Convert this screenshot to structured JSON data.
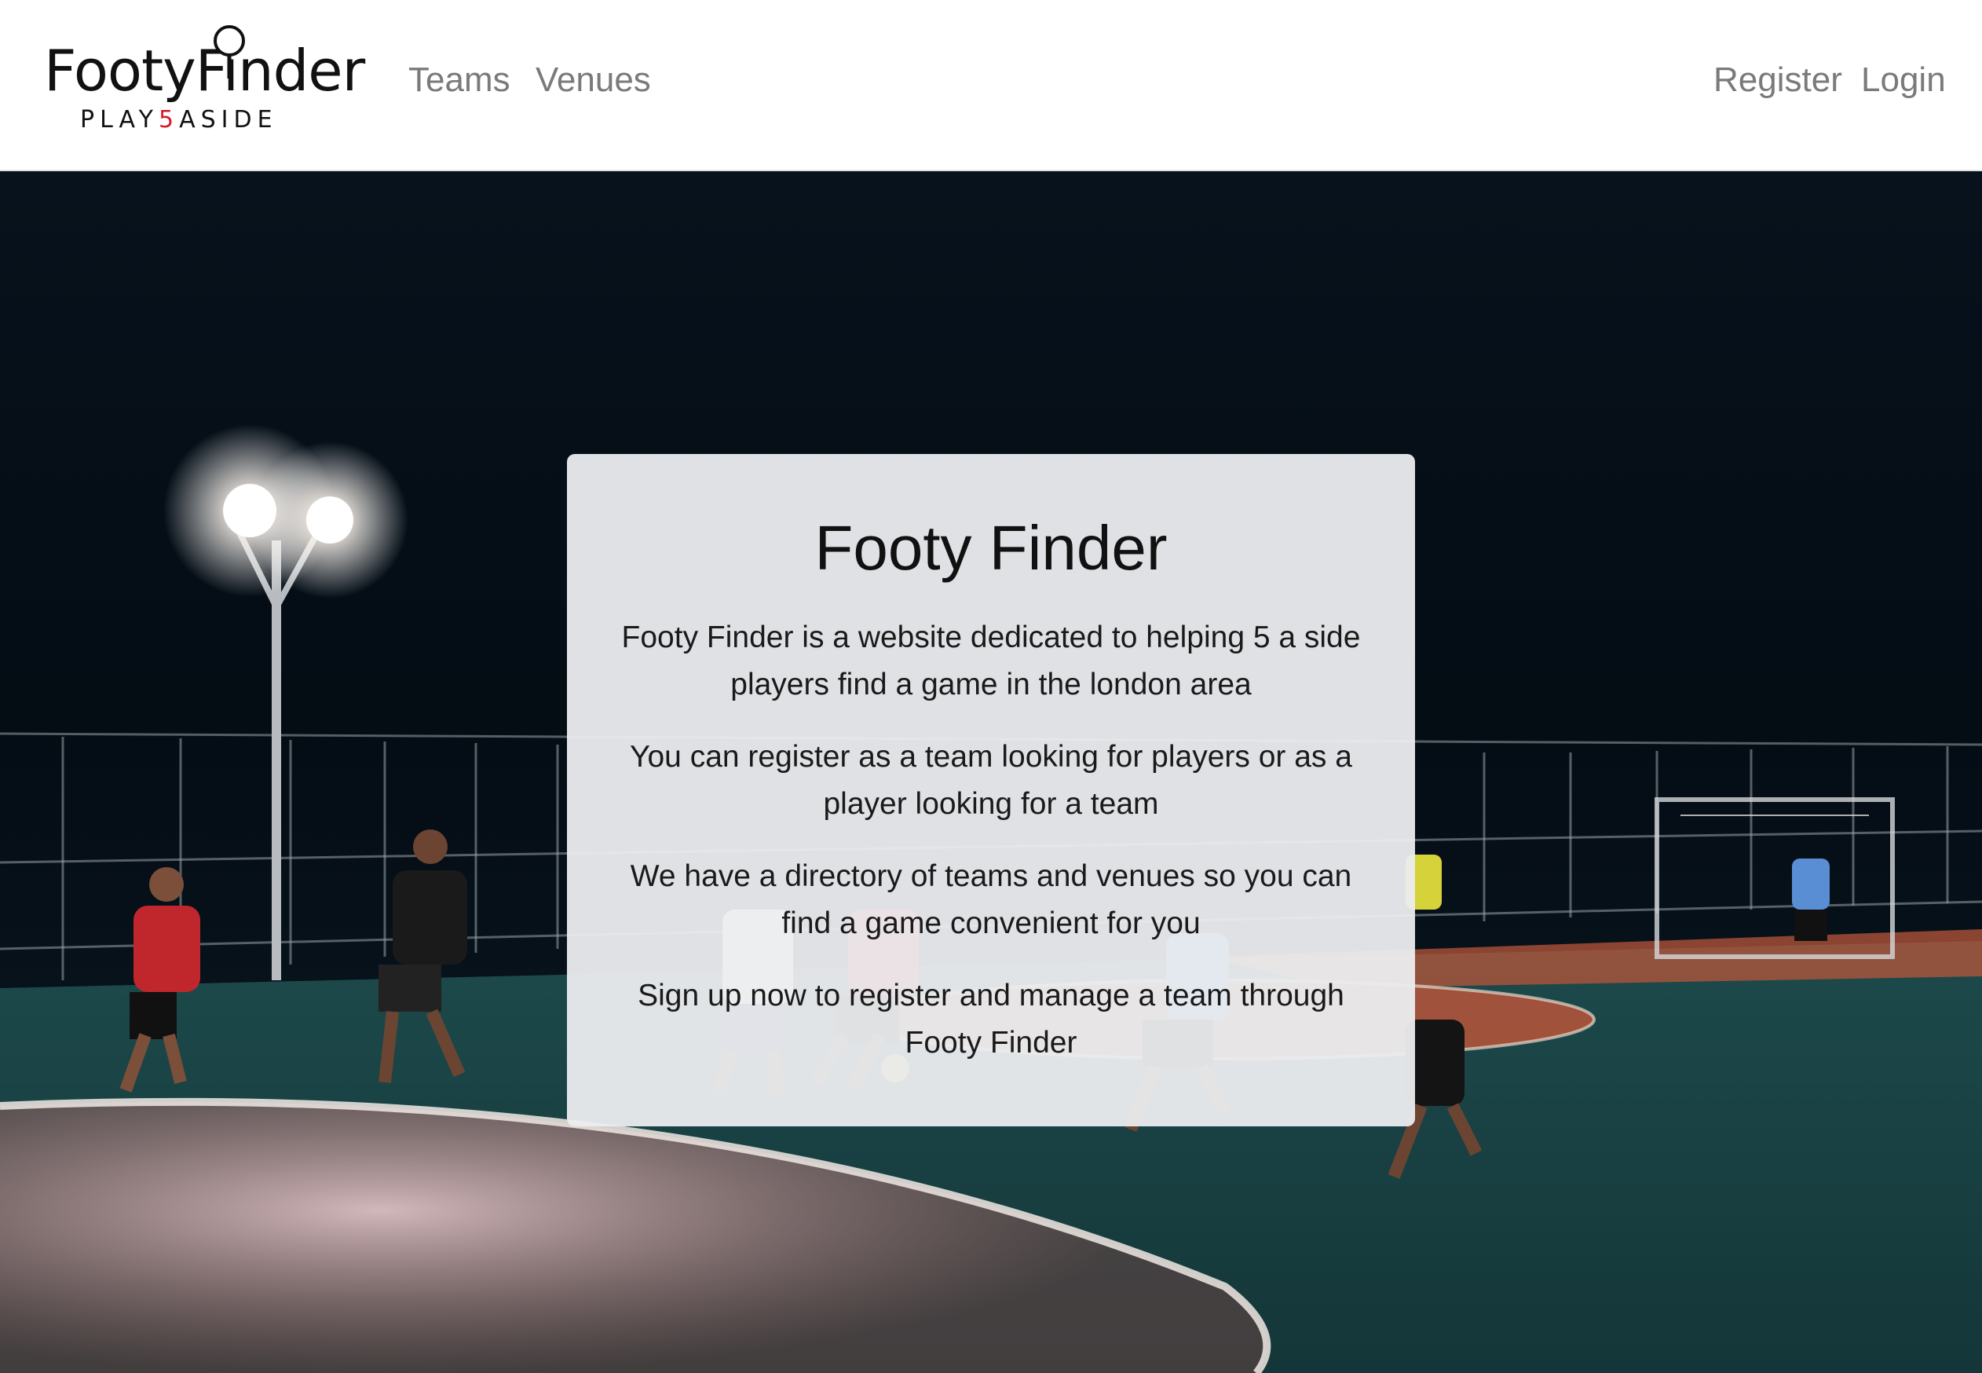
{
  "brand": {
    "logo_main": "FootyFinder",
    "logo_sub_before": "PLAY",
    "logo_sub_highlight": "5",
    "logo_sub_after": "ASIDE",
    "accent_color": "#d7192a"
  },
  "nav": {
    "left": [
      {
        "label": "Teams"
      },
      {
        "label": "Venues"
      }
    ],
    "right": [
      {
        "label": "Register"
      },
      {
        "label": "Login"
      }
    ],
    "link_color": "#7a7a7a"
  },
  "hero": {
    "background": "night 5-a-side football pitch under floodlights"
  },
  "card": {
    "title": "Footy Finder",
    "paragraphs": [
      "Footy Finder is a website dedicated to helping 5 a side players find a game in the london area",
      "You can register as a team looking for players or as a player looking for a team",
      "We have a directory of teams and venues so you can find a game convenient for you",
      "Sign up now to register and manage a team through Footy Finder"
    ]
  }
}
